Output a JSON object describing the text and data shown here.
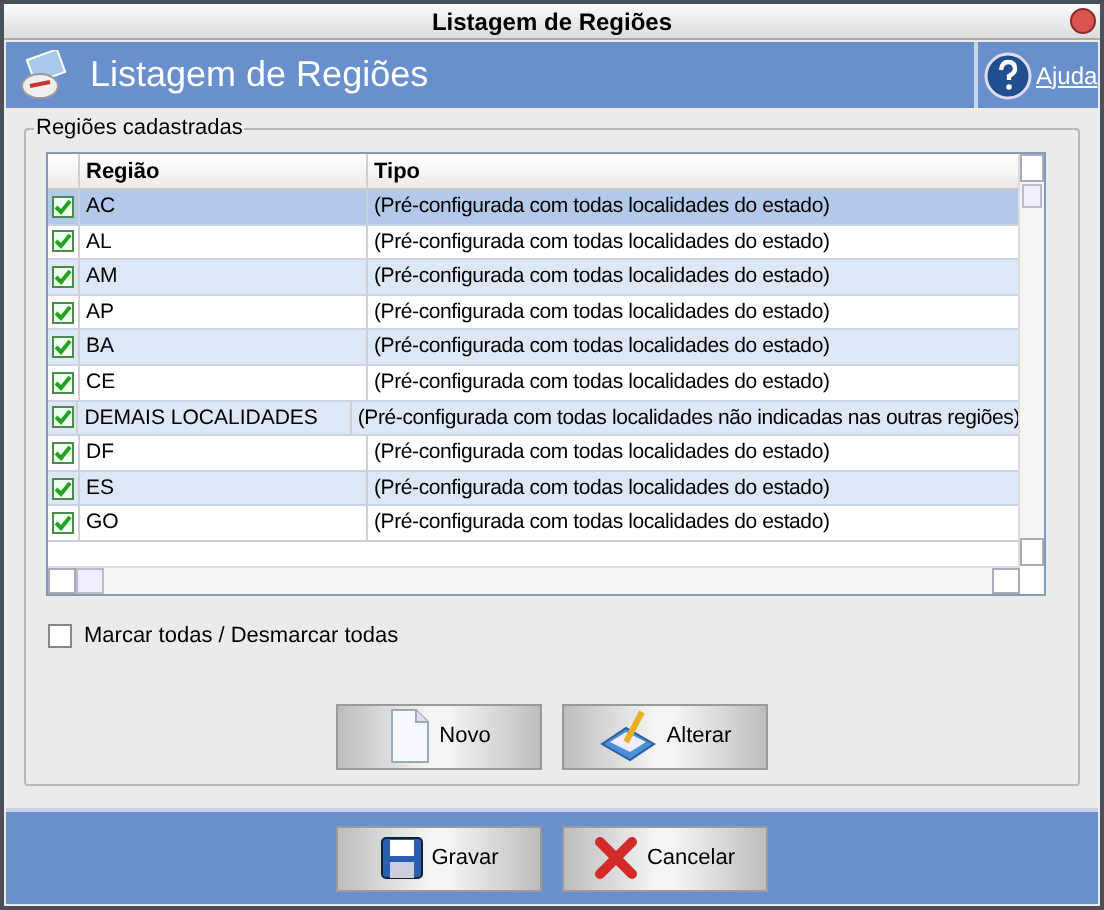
{
  "window": {
    "title": "Listagem de Regiões"
  },
  "header": {
    "title": "Listagem de Regiões",
    "help": "Ajuda"
  },
  "group": {
    "title": "Regiões cadastradas"
  },
  "table": {
    "columns": [
      "Região",
      "Tipo"
    ],
    "rows": [
      {
        "regiao": "AC",
        "tipo": "(Pré-configurada com todas localidades do estado)",
        "checked": true,
        "selected": true
      },
      {
        "regiao": "AL",
        "tipo": "(Pré-configurada com todas localidades do estado)",
        "checked": true,
        "selected": false
      },
      {
        "regiao": "AM",
        "tipo": "(Pré-configurada com todas localidades do estado)",
        "checked": true,
        "selected": false
      },
      {
        "regiao": "AP",
        "tipo": "(Pré-configurada com todas localidades do estado)",
        "checked": true,
        "selected": false
      },
      {
        "regiao": "BA",
        "tipo": "(Pré-configurada com todas localidades do estado)",
        "checked": true,
        "selected": false
      },
      {
        "regiao": "CE",
        "tipo": "(Pré-configurada com todas localidades do estado)",
        "checked": true,
        "selected": false
      },
      {
        "regiao": "DEMAIS LOCALIDADES",
        "tipo": "(Pré-configurada com todas localidades não indicadas nas outras regiões)",
        "checked": true,
        "selected": false
      },
      {
        "regiao": "DF",
        "tipo": "(Pré-configurada com todas localidades do estado)",
        "checked": true,
        "selected": false
      },
      {
        "regiao": "ES",
        "tipo": "(Pré-configurada com todas localidades do estado)",
        "checked": true,
        "selected": false
      },
      {
        "regiao": "GO",
        "tipo": "(Pré-configurada com todas localidades do estado)",
        "checked": true,
        "selected": false
      }
    ]
  },
  "select_all": {
    "label": "Marcar todas / Desmarcar todas",
    "checked": false
  },
  "actions": [
    {
      "kind": "new",
      "label": "Novo"
    },
    {
      "kind": "edit",
      "label": "Alterar"
    }
  ],
  "footer": [
    {
      "kind": "save",
      "label": "Gravar"
    },
    {
      "kind": "cancel",
      "label": "Cancelar"
    }
  ]
}
